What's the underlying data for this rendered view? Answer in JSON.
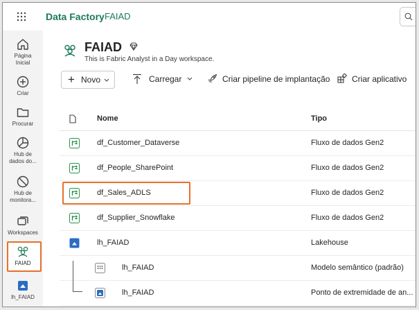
{
  "topbar": {
    "app_name": "Data Factory",
    "workspace": "FAIAD",
    "icons": {
      "launcher": "waffle-icon",
      "search": "search-icon"
    }
  },
  "rail": {
    "items": [
      {
        "label": "Página\nInicial",
        "icon": "home-icon"
      },
      {
        "label": "Criar",
        "icon": "create-icon"
      },
      {
        "label": "Procurar",
        "icon": "folder-icon"
      },
      {
        "label": "Hub de\ndados do...",
        "icon": "data-hub-icon"
      },
      {
        "label": "Hub de\nmonitora...",
        "icon": "monitor-icon"
      },
      {
        "label": "Workspaces",
        "icon": "workspaces-icon"
      },
      {
        "label": "FAIAD",
        "icon": "workspace-icon"
      },
      {
        "label": "lh_FAIAD",
        "icon": "lakehouse-icon"
      }
    ],
    "active": "FAIAD"
  },
  "workspace": {
    "title": "FAIAD",
    "description": "This is Fabric Analyst in a Day workspace."
  },
  "toolbar": {
    "new": "Novo",
    "upload": "Carregar",
    "pipeline": "Criar pipeline de implantação",
    "app": "Criar aplicativo"
  },
  "table": {
    "headers": {
      "name": "Nome",
      "type": "Tipo"
    },
    "rows": [
      {
        "name": "df_Customer_Dataverse",
        "type": "Fluxo de dados Gen2",
        "icon": "dataflow-icon"
      },
      {
        "name": "df_People_SharePoint",
        "type": "Fluxo de dados Gen2",
        "icon": "dataflow-icon"
      },
      {
        "name": "df_Sales_ADLS",
        "type": "Fluxo de dados Gen2",
        "icon": "dataflow-icon",
        "highlighted": true
      },
      {
        "name": "df_Supplier_Snowflake",
        "type": "Fluxo de dados Gen2",
        "icon": "dataflow-icon"
      },
      {
        "name": "lh_FAIAD",
        "type": "Lakehouse",
        "icon": "lakehouse-icon"
      },
      {
        "name": "lh_FAIAD",
        "type": "Modelo semântico (padrão)",
        "icon": "semantic-model-icon"
      },
      {
        "name": "lh_FAIAD",
        "type": "Ponto de extremidade de an...",
        "icon": "sql-endpoint-icon"
      }
    ]
  },
  "colors": {
    "brand_green": "#1b7a55",
    "highlight": "#e7702b",
    "dataflow_green": "#2f8f4e",
    "lakehouse_blue": "#2b6cc4"
  }
}
